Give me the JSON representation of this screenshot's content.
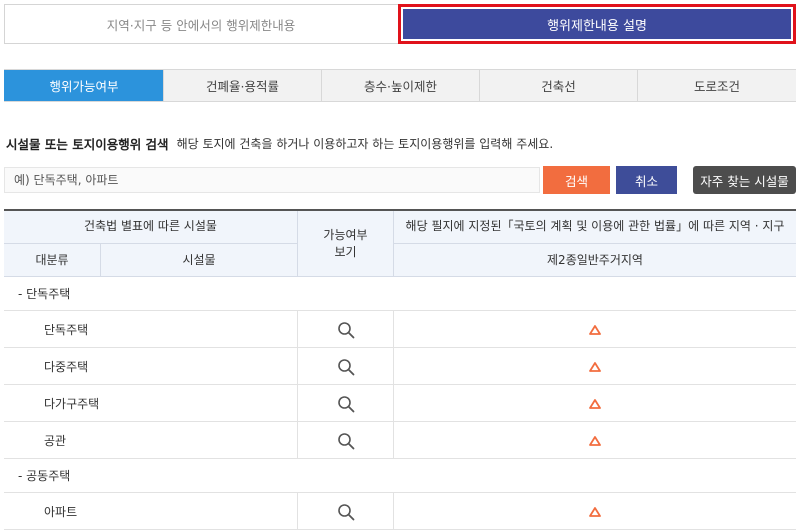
{
  "top_toggle": {
    "left_label": "지역·지구 등 안에서의 행위제한내용",
    "right_label": "행위제한내용 설명"
  },
  "tabs": [
    {
      "label": "행위가능여부",
      "active": true
    },
    {
      "label": "건폐율·용적률",
      "active": false
    },
    {
      "label": "층수·높이제한",
      "active": false
    },
    {
      "label": "건축선",
      "active": false
    },
    {
      "label": "도로조건",
      "active": false
    }
  ],
  "search": {
    "title": "시설물 또는 토지이용행위 검색",
    "description": "해당 토지에 건축을 하거나 이용하고자 하는 토지이용행위를 입력해 주세요.",
    "placeholder": "예) 단독주택, 아파트",
    "search_label": "검색",
    "cancel_label": "취소",
    "frequent_label": "자주 찾는 시설물"
  },
  "table": {
    "header_building": "건축법 별표에 따른 시설물",
    "header_category": "대분류",
    "header_facility": "시설물",
    "header_avail": "가능여부\n보기",
    "header_law": "해당 필지에 지정된「국토의 계획 및 이용에 관한 법률」에 따른 지역 · 지구",
    "header_zone": "제2종일반주거지역",
    "groups": [
      {
        "label": "- 단독주택",
        "items": [
          {
            "name": "단독주택"
          },
          {
            "name": "다중주택"
          },
          {
            "name": "다가구주택"
          },
          {
            "name": "공관"
          }
        ]
      },
      {
        "label": "- 공동주택",
        "items": [
          {
            "name": "아파트"
          }
        ]
      }
    ]
  },
  "icons": {
    "search": "magnifier-icon",
    "status": "triangle-icon"
  },
  "colors": {
    "accent_blue": "#2c93dc",
    "navy": "#3d4a9d",
    "orange": "#f26d3f",
    "dark": "#4d4d4d",
    "highlight_red": "#e0121b",
    "triangle": "#f26d3f"
  }
}
